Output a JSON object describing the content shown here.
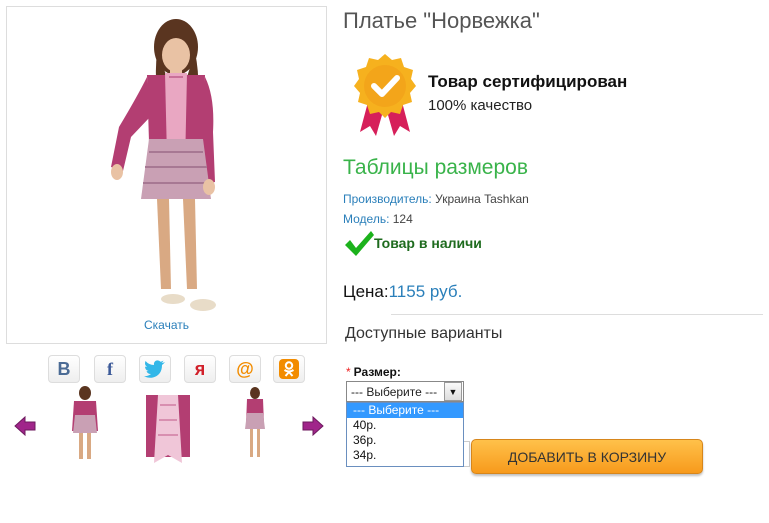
{
  "product": {
    "title": "Платье \"Норвежка\"",
    "download_label": "Скачать",
    "size_table_link": "Таблицы размеров",
    "manufacturer_label": "Производитель:",
    "manufacturer_value": "Украина Tashkan",
    "model_label": "Модель:",
    "model_value": "124",
    "stock_status": "Товар в наличи",
    "price_label": "Цена:",
    "price_value": "1155 руб."
  },
  "certificate": {
    "title": "Товар сертифицирован",
    "subtitle": "100% качество"
  },
  "share": {
    "vk": "В",
    "facebook": "f",
    "twitter": "twitter-icon",
    "yaru": "я",
    "mail": "@",
    "ok": "ok-icon"
  },
  "variants": {
    "heading": "Доступные варианты",
    "required_mark": "*",
    "size_label": "Размер:",
    "selected": "--- Выберите ---",
    "options": [
      "--- Выберите ---",
      "40р.",
      "36р.",
      "34р."
    ]
  },
  "cart": {
    "quantity": "",
    "add_label": "ДОБАВИТЬ В КОРЗИНУ"
  },
  "colors": {
    "accent_green": "#39b34a",
    "link_blue": "#2a7fba",
    "button_orange": "#f79a1c",
    "dress_pink": "#b33e72"
  }
}
